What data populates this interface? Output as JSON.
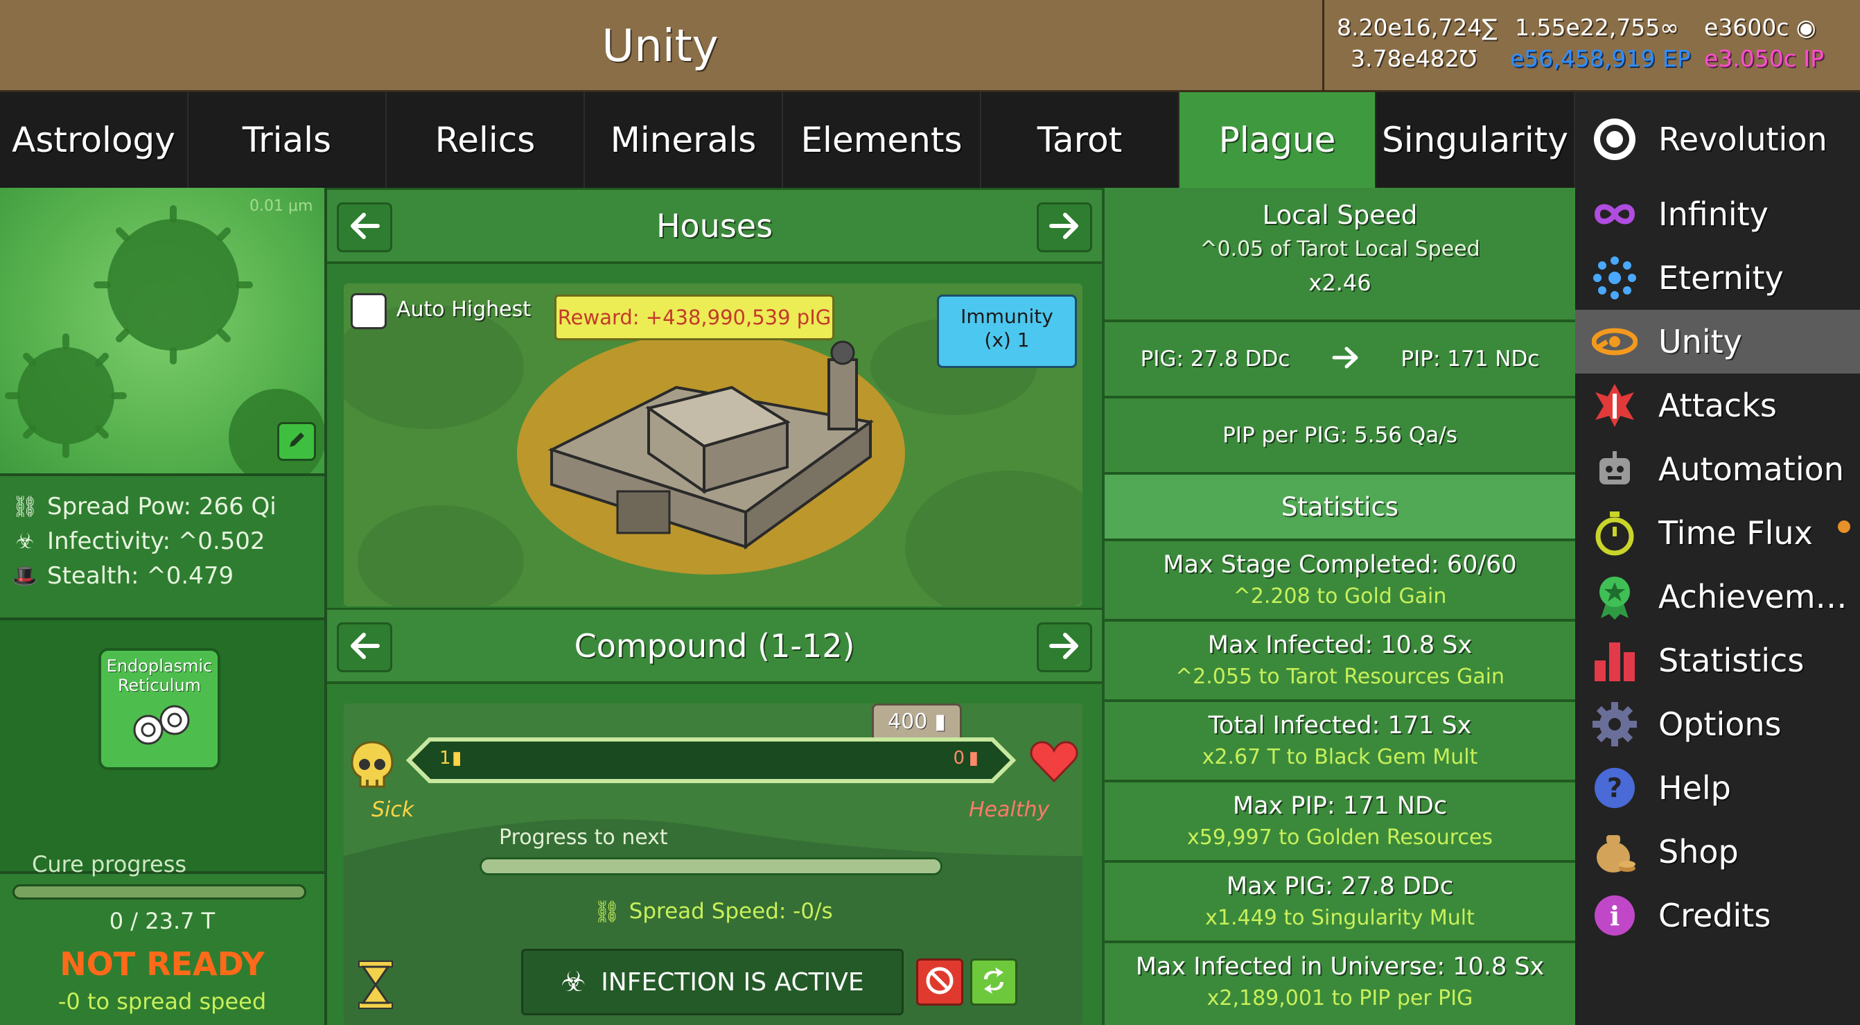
{
  "header": {
    "title": "Unity",
    "resources": {
      "r1": "8.20e16,724∑",
      "r2": "1.55e22,755∞",
      "r3": "e3600c ◉",
      "r4": "3.78e482℧",
      "r5": "e56,458,919 EP",
      "r6": "e3.050c IP"
    }
  },
  "tabs": [
    {
      "label": "Astrology"
    },
    {
      "label": "Trials"
    },
    {
      "label": "Relics"
    },
    {
      "label": "Minerals"
    },
    {
      "label": "Elements"
    },
    {
      "label": "Tarot"
    },
    {
      "label": "Plague",
      "active": true
    },
    {
      "label": "Singularity"
    }
  ],
  "sidebar": {
    "items": [
      {
        "label": "Revolution",
        "icon": "revolution-icon"
      },
      {
        "label": "Infinity",
        "icon": "infinity-icon"
      },
      {
        "label": "Eternity",
        "icon": "eternity-icon"
      },
      {
        "label": "Unity",
        "icon": "unity-icon",
        "active": true
      },
      {
        "label": "Attacks",
        "icon": "attacks-icon"
      },
      {
        "label": "Automation",
        "icon": "robot-icon"
      },
      {
        "label": "Time Flux",
        "icon": "stopwatch-icon"
      },
      {
        "label": "Achievements",
        "icon": "medal-icon"
      },
      {
        "label": "Statistics",
        "icon": "bar-chart-icon"
      },
      {
        "label": "Options",
        "icon": "gear-icon"
      },
      {
        "label": "Help",
        "icon": "question-icon"
      },
      {
        "label": "Shop",
        "icon": "money-bag-icon"
      },
      {
        "label": "Credits",
        "icon": "info-icon"
      }
    ]
  },
  "left": {
    "scale_label": "0.01 μm",
    "stats": [
      {
        "label": "Spread Pow: 266 Qi",
        "icon": "spread-icon"
      },
      {
        "label": "Infectivity: ^0.502",
        "icon": "biohazard-icon"
      },
      {
        "label": "Stealth: ^0.479",
        "icon": "hat-icon"
      }
    ],
    "organelle": "Endoplasmic Reticulum",
    "cure_label": "Cure progress",
    "cure_value": "0 / 23.7 T",
    "cure_status": "NOT READY",
    "cure_effect": "-0 to spread speed"
  },
  "center": {
    "location_title": "Houses",
    "auto_highest": "Auto Highest",
    "reward": "Reward: +438,990,539 pIG",
    "immunity": "Immunity\n(x) 1",
    "stage_title": "Compound (1-12)",
    "population": "400",
    "sick_count": "1",
    "healthy_count": "0",
    "sick_label": "Sick",
    "healthy_label": "Healthy",
    "progress_label": "Progress to next",
    "spread_speed": "Spread Speed: -0/s",
    "infection_button": "INFECTION IS ACTIVE"
  },
  "stats": {
    "local_speed_title": "Local Speed",
    "local_speed_desc": "^0.05 of Tarot Local Speed",
    "local_speed_value": "x2.46",
    "pig": "PIG: 27.8 DDc",
    "pip": "PIP: 171 NDc",
    "pip_per_pig": "PIP per PIG: 5.56 Qa/s",
    "statistics_title": "Statistics",
    "entries": [
      {
        "title": "Max Stage Completed: 60/60",
        "effect": "^2.208 to Gold Gain"
      },
      {
        "title": "Max Infected: 10.8 Sx",
        "effect": "^2.055 to Tarot Resources Gain"
      },
      {
        "title": "Total Infected: 171 Sx",
        "effect": "x2.67 T to Black Gem Mult"
      },
      {
        "title": "Max PIP: 171 NDc",
        "effect": "x59,997 to Golden Resources"
      },
      {
        "title": "Max PIG: 27.8 DDc",
        "effect": "x1.449 to Singularity Mult"
      },
      {
        "title": "Max Infected in Universe: 10.8 Sx",
        "effect": "x2,189,001 to PIP per PIG"
      }
    ]
  },
  "colors": {
    "header_bg": "#8a6e47",
    "plague_green": "#3f9a3f",
    "effect_text": "#c8f05a",
    "not_ready": "#ff6a1a",
    "ep_blue": "#2f8fff",
    "ip_pink": "#ff4fd0"
  }
}
